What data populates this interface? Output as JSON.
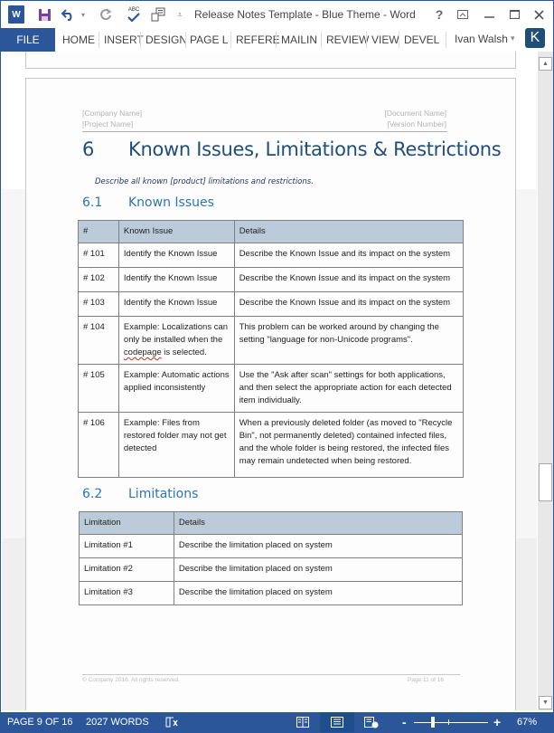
{
  "window": {
    "title": "Release Notes Template - Blue Theme - Word",
    "app_icon": "word-logo-icon",
    "quick_access": [
      {
        "name": "save-icon",
        "glyph": "💾"
      },
      {
        "name": "undo-icon",
        "glyph": "↶"
      },
      {
        "name": "redo-icon",
        "glyph": "↻"
      },
      {
        "name": "spelling-check-icon",
        "glyph": "ABC✓"
      },
      {
        "name": "new-from-template-icon",
        "glyph": "⎘"
      },
      {
        "name": "customize-toolbar-icon",
        "glyph": "⩡"
      }
    ],
    "controls": {
      "help": "?",
      "ribbon_display": "⊼",
      "minimize": "—",
      "maximize": "☐",
      "close": "✕"
    }
  },
  "ribbon": {
    "tabs": [
      "FILE",
      "HOME",
      "INSERT",
      "DESIGN",
      "PAGE L",
      "REFERE",
      "MAILIN",
      "REVIEW",
      "VIEW",
      "DEVEL"
    ],
    "user_name": "Ivan Walsh",
    "user_caret": "▾",
    "avatar_letter": "K"
  },
  "document": {
    "header": {
      "company": "[Company Name]",
      "project": "[Project Name]",
      "document_name": "[Document Name]",
      "version": "[Version Number]"
    },
    "section": {
      "number": "6",
      "title": "Known Issues, Limitations & Restrictions",
      "intro": "Describe all known [product] limitations and restrictions."
    },
    "known_issues": {
      "number": "6.1",
      "title": "Known Issues",
      "columns": [
        "#",
        "Known Issue",
        "Details"
      ],
      "rows": [
        {
          "id": "# 101",
          "issue": "Identify the Known Issue",
          "details": "Describe the Known Issue and its impact on the system"
        },
        {
          "id": "# 102",
          "issue": "Identify the Known Issue",
          "details": "Describe the Known Issue and its impact on the system"
        },
        {
          "id": "# 103",
          "issue": "Identify the Known Issue",
          "details": "Describe the Known Issue and its impact on the system"
        },
        {
          "id": "# 104",
          "issue_pre": "Example: Localizations can only be installed when the ",
          "issue_flag": "codepage",
          "issue_post": " is selected.",
          "details": "This problem can be worked around by changing the setting \"language for non-Unicode programs\"."
        },
        {
          "id": "# 105",
          "issue": "Example: Automatic actions applied inconsistently",
          "details": "Use the \"Ask after scan\" settings for both applications, and then select the appropriate action for each detected item individually."
        },
        {
          "id": "# 106",
          "issue": "Example: Files from restored folder may not get detected",
          "details": "When a previously deleted folder (as moved to \"Recycle Bin\", not permanently deleted) contained infected files, and the whole folder is being restored, the infected files may remain undetected when being restored."
        }
      ]
    },
    "limitations": {
      "number": "6.2",
      "title": "Limitations",
      "columns": [
        "Limitation",
        "Details"
      ],
      "rows": [
        {
          "name": "Limitation #1",
          "details": "Describe the limitation placed on system"
        },
        {
          "name": "Limitation #2",
          "details": "Describe the limitation placed on system"
        },
        {
          "name": "Limitation #3",
          "details": "Describe the limitation placed on system"
        }
      ]
    },
    "footer": {
      "copyright": "© Company 2016. All rights reserved.",
      "page": "Page 11 of 16"
    }
  },
  "status_bar": {
    "page": "PAGE 9 OF 16",
    "words": "2027 WORDS",
    "proofing_icon": "📖",
    "zoom_minus": "-",
    "zoom_plus": "+",
    "zoom_level": "67%",
    "zoom_percent": 67
  },
  "colors": {
    "accent": "#2b579a",
    "heading": "#1f4e79",
    "table_header": "#bccbda"
  }
}
